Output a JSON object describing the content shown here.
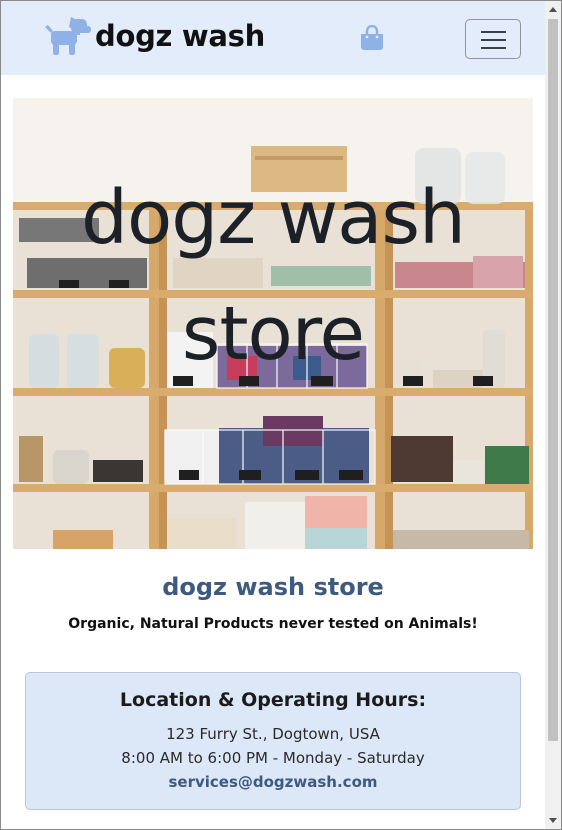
{
  "navbar": {
    "brand_name": "dogz wash",
    "colors": {
      "background": "#e2ecfb",
      "icon": "#8fb1e8"
    },
    "icons": [
      "dog-icon",
      "shopping-bag-icon",
      "hamburger-menu-icon"
    ]
  },
  "hero": {
    "title": "dogz wash store",
    "image_subject": "store-shelves"
  },
  "store": {
    "heading": "dogz wash store",
    "tagline": "Organic, Natural Products never tested on Animals!"
  },
  "info": {
    "title": "Location & Operating Hours:",
    "address": "123 Furry St., Dogtown, USA",
    "hours": "8:00 AM to 6:00 PM - Monday - Saturday",
    "email": "services@dogzwash.com",
    "colors": {
      "background": "#dce7f8",
      "accent": "#3e5a7e"
    }
  }
}
